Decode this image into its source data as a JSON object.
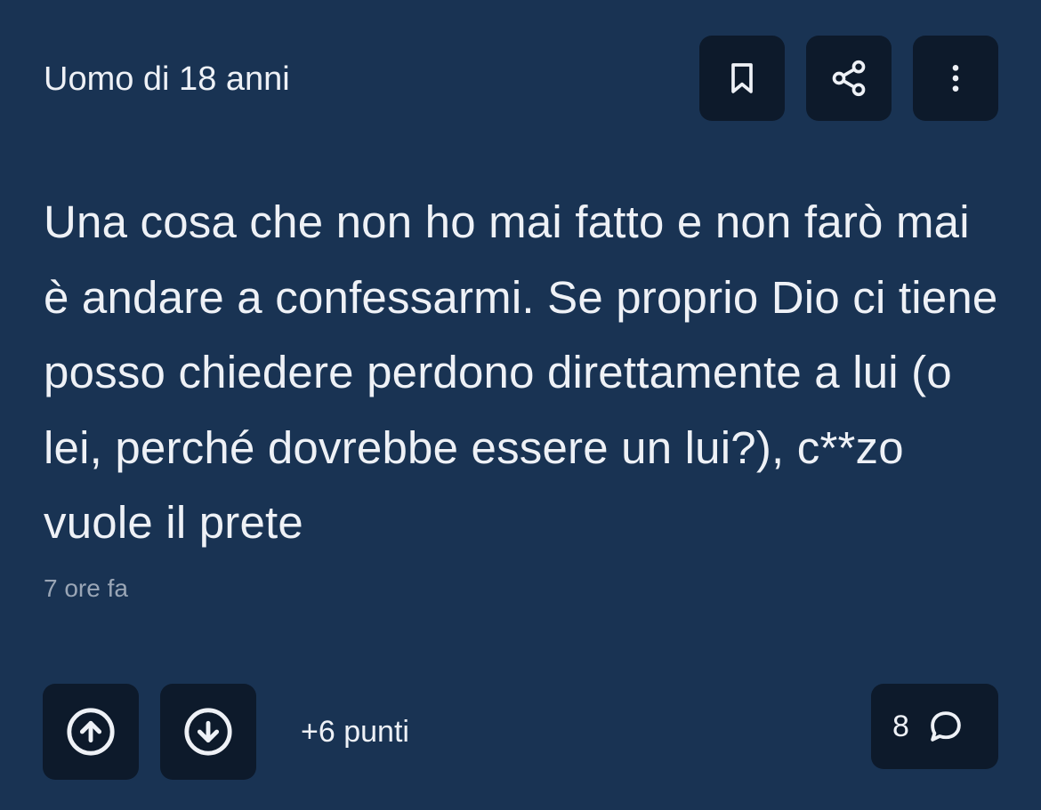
{
  "post": {
    "author": "Uomo di 18 anni",
    "text": "Una cosa che non ho mai fatto e non farò mai è andare a confessarmi. Se proprio Dio ci tiene posso chiedere perdono direttamente a lui (o lei, perché dovrebbe essere un lui?), c**zo vuole il prete",
    "timestamp": "7 ore fa",
    "score": "+6 punti",
    "comments_count": "8"
  },
  "icons": {
    "bookmark": "bookmark-icon",
    "share": "share-icon",
    "more": "more-vertical-icon",
    "upvote": "arrow-up-circle-icon",
    "downvote": "arrow-down-circle-icon",
    "comment": "comment-bubble-icon"
  },
  "colors": {
    "background": "#193353",
    "button": "#0d1a2b",
    "text": "#eef1f6",
    "muted": "#9aa6b6"
  }
}
